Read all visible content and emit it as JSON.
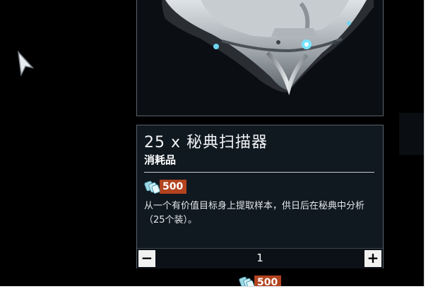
{
  "item": {
    "title": "25 x 秘典扫描器",
    "category": "消耗品",
    "price": "500",
    "description": "从一个有价值目标身上提取样本，供日后在秘典中分析（25个装）。"
  },
  "quantity": {
    "minus_label": "−",
    "value": "1",
    "plus_label": "+"
  },
  "next_item": {
    "price": "500"
  },
  "icons": {
    "cursor": "cursor-pointer-icon",
    "currency": "platinum-icon"
  },
  "colors": {
    "price_badge": "#b3431f",
    "panel_bg": "#101820",
    "panel_border": "#5b636b"
  }
}
